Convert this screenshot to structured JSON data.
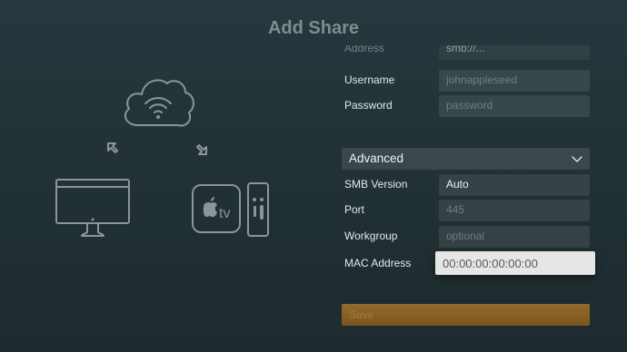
{
  "title": "Add Share",
  "fields": {
    "address": {
      "label": "Address",
      "value": "smb://..."
    },
    "username": {
      "label": "Username",
      "value": "johnappleseed"
    },
    "password": {
      "label": "Password",
      "placeholder": "password"
    }
  },
  "advanced": {
    "label": "Advanced",
    "smb_version": {
      "label": "SMB Version",
      "value": "Auto"
    },
    "port": {
      "label": "Port",
      "placeholder": "445"
    },
    "workgroup": {
      "label": "Workgroup",
      "placeholder": "optional"
    },
    "mac_address": {
      "label": "MAC Address",
      "value": "00:00:00:00:00:00"
    }
  },
  "save_label": "Save",
  "icons": {
    "cloud": "cloud-wifi-icon",
    "computer": "imac-icon",
    "tv": "apple-tv-icon",
    "remote": "remote-icon",
    "arrow_left": "arrow-up-left-icon",
    "arrow_right": "arrow-down-right-icon",
    "chevron": "chevron-down-icon"
  },
  "illustration": {
    "tv_text": "tv"
  }
}
